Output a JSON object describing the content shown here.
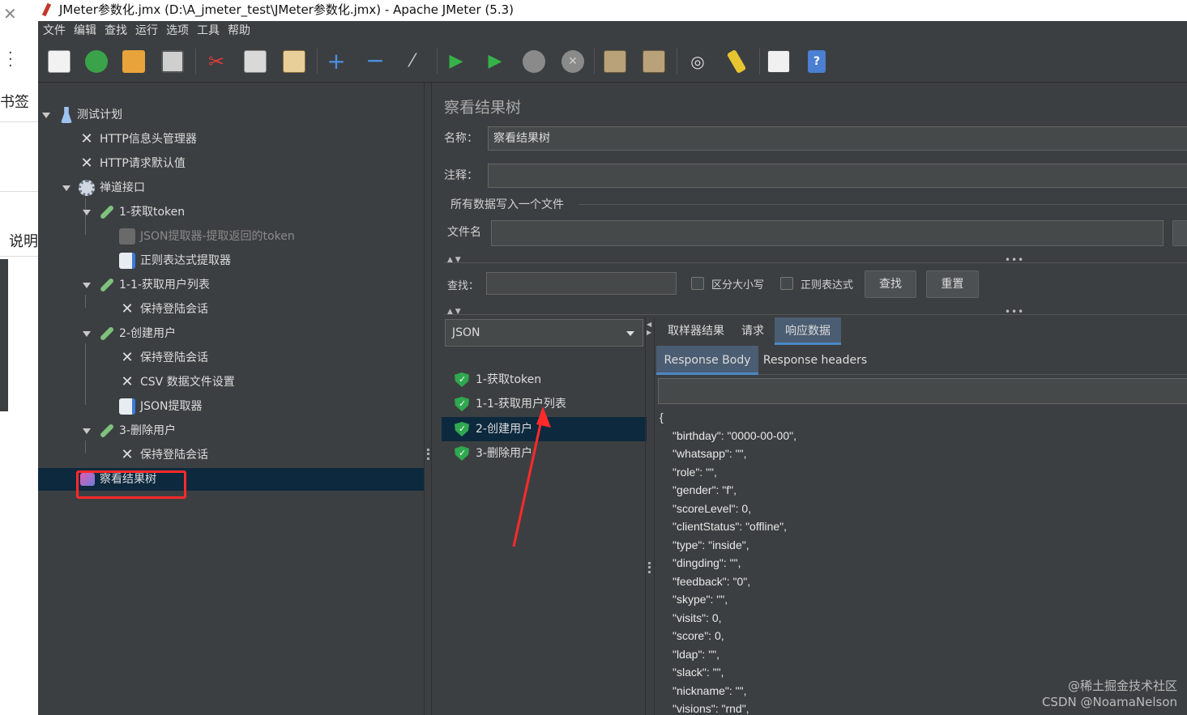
{
  "window": {
    "title": "JMeter参数化.jmx (D:\\A_jmeter_test\\JMeter参数化.jmx) - Apache JMeter (5.3)"
  },
  "background_app": {
    "labels": [
      "书签",
      "说明"
    ]
  },
  "menu": [
    "文件",
    "编辑",
    "查找",
    "运行",
    "选项",
    "工具",
    "帮助"
  ],
  "toolbar": {
    "icons": [
      "new-icon",
      "templates-icon",
      "open-icon",
      "save-icon",
      "cut-icon",
      "copy-icon",
      "paste-icon",
      "expand-icon",
      "collapse-icon",
      "toggle-icon",
      "start-icon",
      "start-no-pause-icon",
      "stop-icon",
      "shutdown-icon",
      "clear-icon",
      "clear-all-icon",
      "search-icon",
      "reset-search-icon",
      "function-helper-icon",
      "help-icon"
    ]
  },
  "tree": {
    "nodes": [
      {
        "label": "测试计划",
        "level": 0,
        "icon": "test-plan-icon"
      },
      {
        "label": "HTTP信息头管理器",
        "level": 1,
        "icon": "config-element-icon"
      },
      {
        "label": "HTTP请求默认值",
        "level": 1,
        "icon": "config-element-icon"
      },
      {
        "label": "禅道接口",
        "level": 1,
        "icon": "thread-group-icon"
      },
      {
        "label": "1-获取token",
        "level": 2,
        "icon": "sampler-icon"
      },
      {
        "label": "JSON提取器-提取返回的token",
        "level": 3,
        "icon": "extractor-icon",
        "disabled": true
      },
      {
        "label": "正则表达式提取器",
        "level": 3,
        "icon": "extractor-icon"
      },
      {
        "label": "1-1-获取用户列表",
        "level": 2,
        "icon": "sampler-icon"
      },
      {
        "label": "保持登陆会话",
        "level": 3,
        "icon": "config-element-icon"
      },
      {
        "label": "2-创建用户",
        "level": 2,
        "icon": "sampler-icon"
      },
      {
        "label": "保持登陆会话",
        "level": 3,
        "icon": "config-element-icon"
      },
      {
        "label": "CSV 数据文件设置",
        "level": 3,
        "icon": "config-element-icon"
      },
      {
        "label": "JSON提取器",
        "level": 3,
        "icon": "extractor-icon"
      },
      {
        "label": "3-删除用户",
        "level": 2,
        "icon": "sampler-icon"
      },
      {
        "label": "保持登陆会话",
        "level": 3,
        "icon": "config-element-icon"
      },
      {
        "label": "察看结果树",
        "level": 1,
        "icon": "listener-icon",
        "selected": true
      }
    ]
  },
  "panel": {
    "title": "察看结果树",
    "name_label": "名称：",
    "name_value": "察看结果树",
    "comment_label": "注释：",
    "comment_value": "",
    "file_section": "所有数据写入一个文件",
    "filename_label": "文件名",
    "filename_value": "",
    "search_label": "查找：",
    "search_value": "",
    "case_sensitive": "区分大小写",
    "regex": "正则表达式",
    "find_button": "查找",
    "reset_button": "重置",
    "renderer": "JSON"
  },
  "results": {
    "items": [
      {
        "label": "1-获取token",
        "status": "success"
      },
      {
        "label": "1-1-获取用户列表",
        "status": "success"
      },
      {
        "label": "2-创建用户",
        "status": "success",
        "selected": true
      },
      {
        "label": "3-删除用户",
        "status": "success"
      }
    ]
  },
  "tabs": [
    "取样器结果",
    "请求",
    "响应数据"
  ],
  "active_tab": "响应数据",
  "subtabs": [
    "Response Body",
    "Response headers"
  ],
  "active_subtab": "Response Body",
  "response_body": [
    "{",
    "\"birthday\": \"0000-00-00\",",
    "\"whatsapp\": \"\",",
    "\"role\": \"\",",
    "\"gender\": \"f\",",
    "\"scoreLevel\": 0,",
    "\"clientStatus\": \"offline\",",
    "\"type\": \"inside\",",
    "\"dingding\": \"\",",
    "\"feedback\": \"0\",",
    "\"skype\": \"\",",
    "\"visits\": 0,",
    "\"score\": 0,",
    "\"ldap\": \"\",",
    "\"slack\": \"\",",
    "\"nickname\": \"\",",
    "\"visions\": \"rnd\","
  ],
  "watermark": [
    "@稀土掘金技术社区",
    "CSDN @NoamaNelson"
  ],
  "colors": {
    "background": "#3c3f41",
    "selection": "#0d293e",
    "annotation": "#ff2a2a",
    "success": "#2fa84f"
  }
}
